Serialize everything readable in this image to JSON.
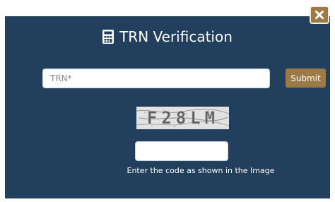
{
  "modal": {
    "title": "TRN Verification",
    "title_icon": "calculator-icon",
    "close_icon": "close-icon",
    "colors": {
      "background": "#233f5e",
      "accent": "#9b7a45",
      "text": "#ffffff"
    }
  },
  "form": {
    "trn_placeholder": "TRN*",
    "submit_label": "Submit",
    "captcha_text": "F28LM",
    "code_placeholder": "",
    "hint": "Enter the code as shown in the Image"
  }
}
